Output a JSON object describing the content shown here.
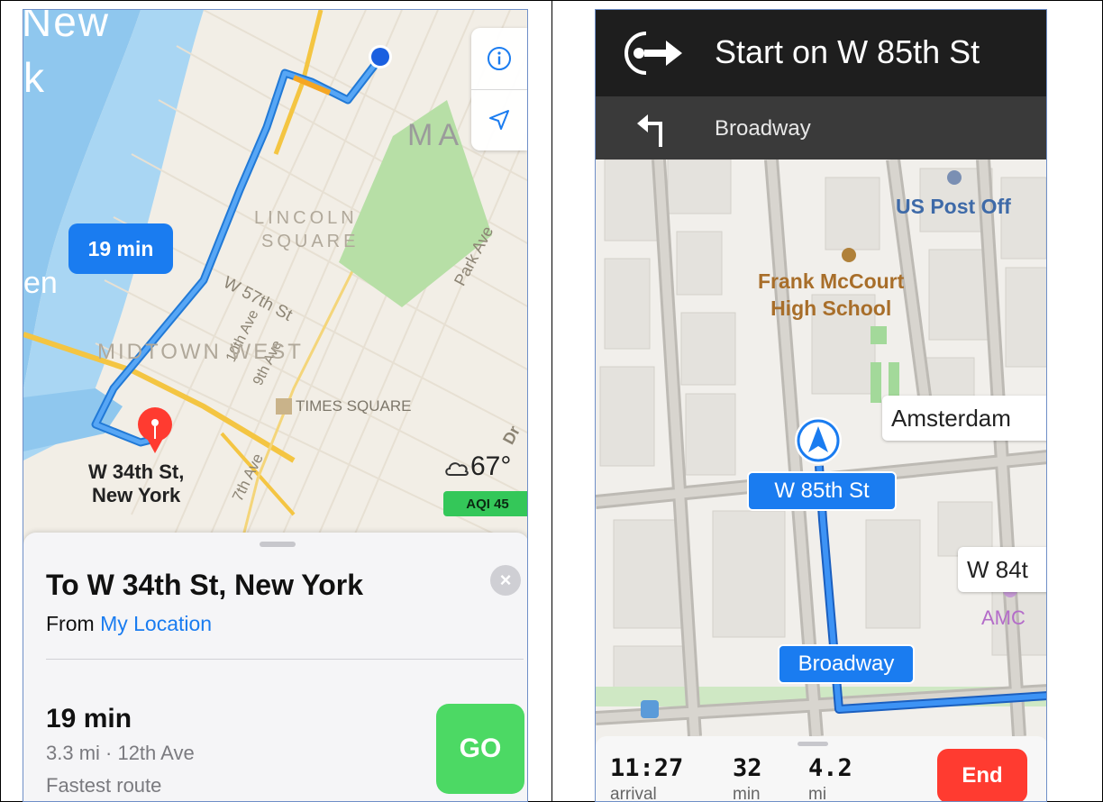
{
  "left_panel": {
    "map_labels": {
      "new": "New",
      "k": "k",
      "en": "en",
      "ma": "MA",
      "lincoln_square": [
        "LINCOLN",
        "SQUARE"
      ],
      "w57": "W 57th St",
      "park_ave": "Park Ave",
      "tenth_ave": "10th Ave",
      "ninth_ave": "9th Ave",
      "midtown_west": "MIDTOWN WEST",
      "times_square": "TIMES SQUARE",
      "seventh_ave": "7th Ave",
      "dr": "Dr",
      "destination": [
        "W 34th St,",
        "New York"
      ]
    },
    "route_bubble": "19 min",
    "weather_temp": "67°",
    "aqi": "AQI 45",
    "sheet": {
      "title": "To W 34th St, New York",
      "from_prefix": "From ",
      "from_link": "My Location",
      "route_time": "19 min",
      "route_info": "3.3 mi · 12th Ave",
      "route_type": "Fastest route",
      "go": "GO",
      "close": "×"
    },
    "icons": {
      "info": "info-icon",
      "location": "location-arrow-icon",
      "weather": "cloud-icon"
    },
    "colors": {
      "route": "#1a7cf0",
      "go": "#4cd964",
      "pin": "#ff3b30",
      "aqi": "#34c759"
    }
  },
  "right_panel": {
    "instruction": "Start on W 85th St",
    "next_instruction": "Broadway",
    "map_labels": {
      "post_office": "US Post Off",
      "school": [
        "Frank McCourt",
        "High School"
      ],
      "amsterdam": "Amsterdam",
      "w85": "W 85th St",
      "w84": "W 84t",
      "amc": "AMC",
      "broadway": "Broadway"
    },
    "stats": [
      {
        "value": "11:27",
        "label": "arrival"
      },
      {
        "value": "32",
        "label": "min"
      },
      {
        "value": "4.2",
        "label": "mi"
      }
    ],
    "end": "End",
    "icons": {
      "start": "start-route-icon",
      "turn": "turn-left-icon",
      "heading": "heading-arrow-icon"
    },
    "colors": {
      "end": "#ff3b30",
      "route": "#1a7cf0"
    }
  }
}
